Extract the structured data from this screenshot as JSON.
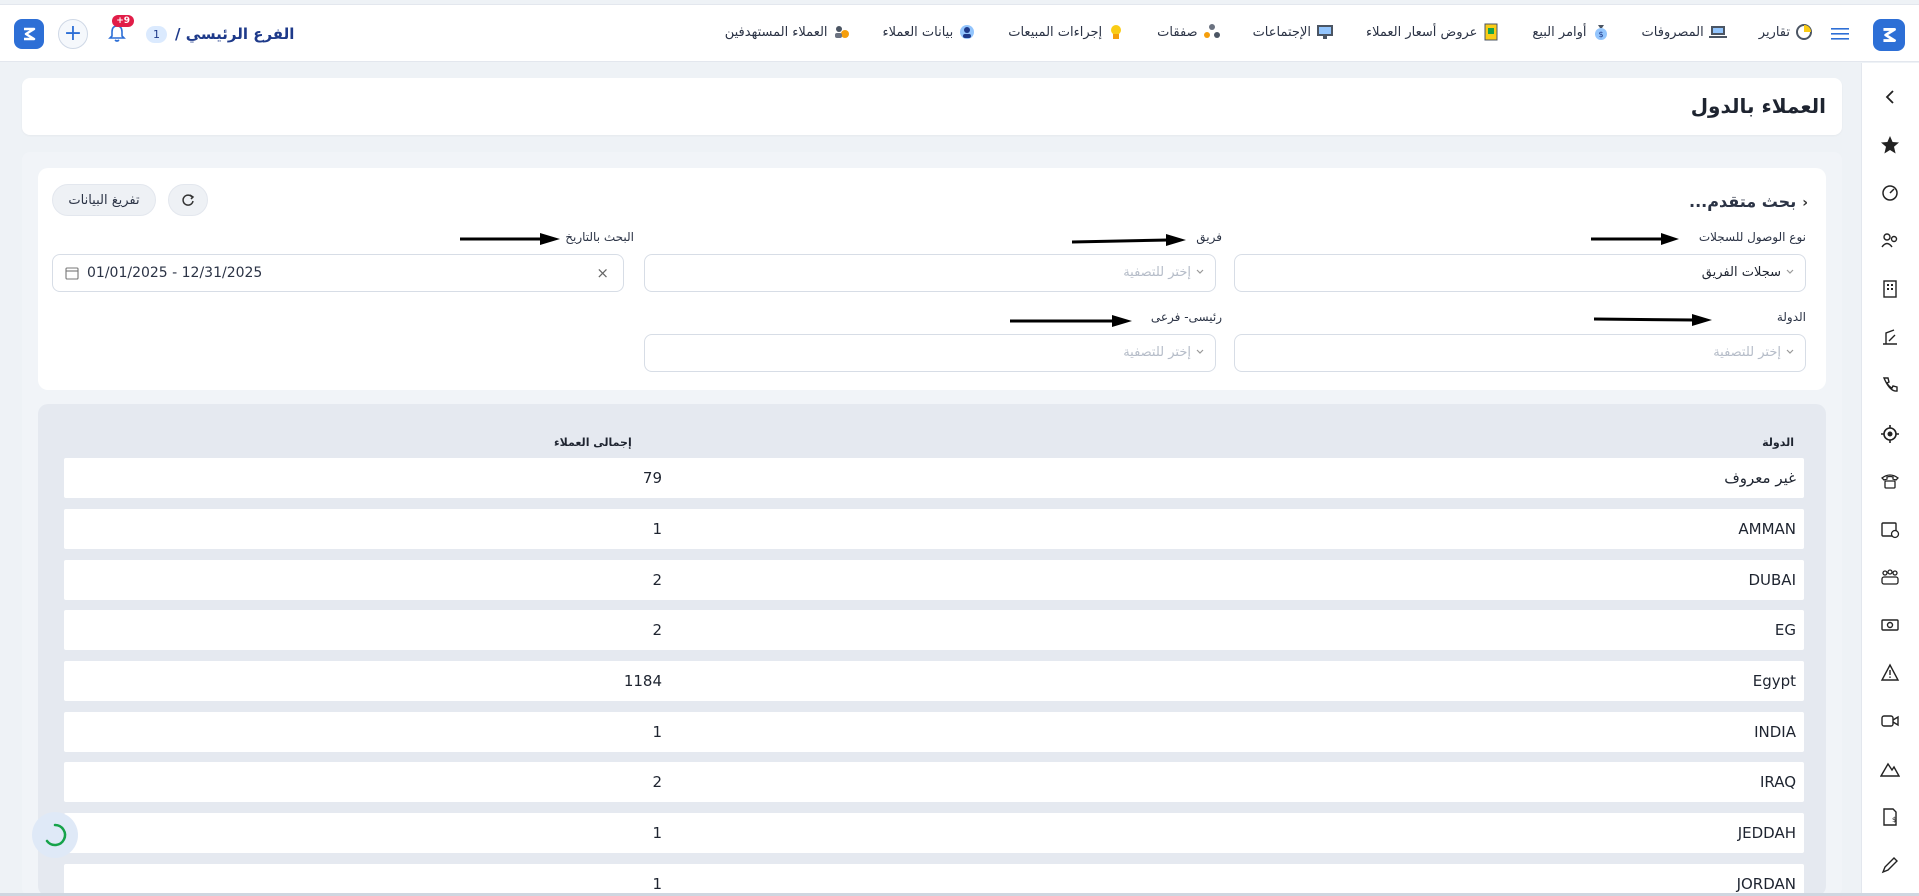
{
  "header": {
    "branch_name": "الفرع الرئيسي /",
    "branch_count": "1",
    "notification_badge": "+9",
    "nav": [
      {
        "label": "العملاء المستهدفين",
        "icon": "users-target-icon"
      },
      {
        "label": "بيانات العملاء",
        "icon": "client-data-icon"
      },
      {
        "label": "إجراءات المبيعات",
        "icon": "sales-actions-icon"
      },
      {
        "label": "صفقات",
        "icon": "deals-icon"
      },
      {
        "label": "الإجتماعات",
        "icon": "meetings-icon"
      },
      {
        "label": "عروض أسعار العملاء",
        "icon": "quotes-icon"
      },
      {
        "label": "أوامر البيع",
        "icon": "sales-orders-icon"
      },
      {
        "label": "المصروفات",
        "icon": "expenses-icon"
      },
      {
        "label": "تقارير",
        "icon": "reports-icon"
      }
    ]
  },
  "page": {
    "title": "العملاء بالدول"
  },
  "filters": {
    "advanced_search": "بحث متقدم...",
    "reset_button": "تفريغ البيانات",
    "access_type_label": "نوع الوصول للسجلات",
    "access_type_value": "سجلات الفريق",
    "team_label": "فريق",
    "team_placeholder": "إختر للتصفية",
    "date_label": "البحث بالتاريخ",
    "date_value": "01/01/2025 - 12/31/2025",
    "country_label": "الدولة",
    "country_placeholder": "إختر للتصفية",
    "main_sub_label": "رئيسى- فرعى",
    "main_sub_placeholder": "إختر للتصفية"
  },
  "table": {
    "col_country": "الدولة",
    "col_total": "إجمالى العملاء",
    "rows": [
      {
        "country": "غير معروف",
        "total": "79"
      },
      {
        "country": "AMMAN",
        "total": "1"
      },
      {
        "country": "DUBAI",
        "total": "2"
      },
      {
        "country": "EG",
        "total": "2"
      },
      {
        "country": "Egypt",
        "total": "1184"
      },
      {
        "country": "INDIA",
        "total": "1"
      },
      {
        "country": "IRAQ",
        "total": "2"
      },
      {
        "country": "JEDDAH",
        "total": "1"
      },
      {
        "country": "JORDAN",
        "total": "1"
      }
    ]
  },
  "sidebar": {
    "items": [
      "collapse-icon",
      "star-icon",
      "dashboard-icon",
      "users-icon",
      "building-icon",
      "tools-icon",
      "phone-icon",
      "target-icon",
      "telephone-icon",
      "calendar-icon",
      "team-icon",
      "money-icon",
      "warning-icon",
      "video-icon",
      "mountain-icon",
      "invoice-icon",
      "pen-icon"
    ]
  },
  "colors": {
    "brand": "#2d6fd6",
    "badge": "#e11d48",
    "page_bg": "#eef2f6"
  }
}
